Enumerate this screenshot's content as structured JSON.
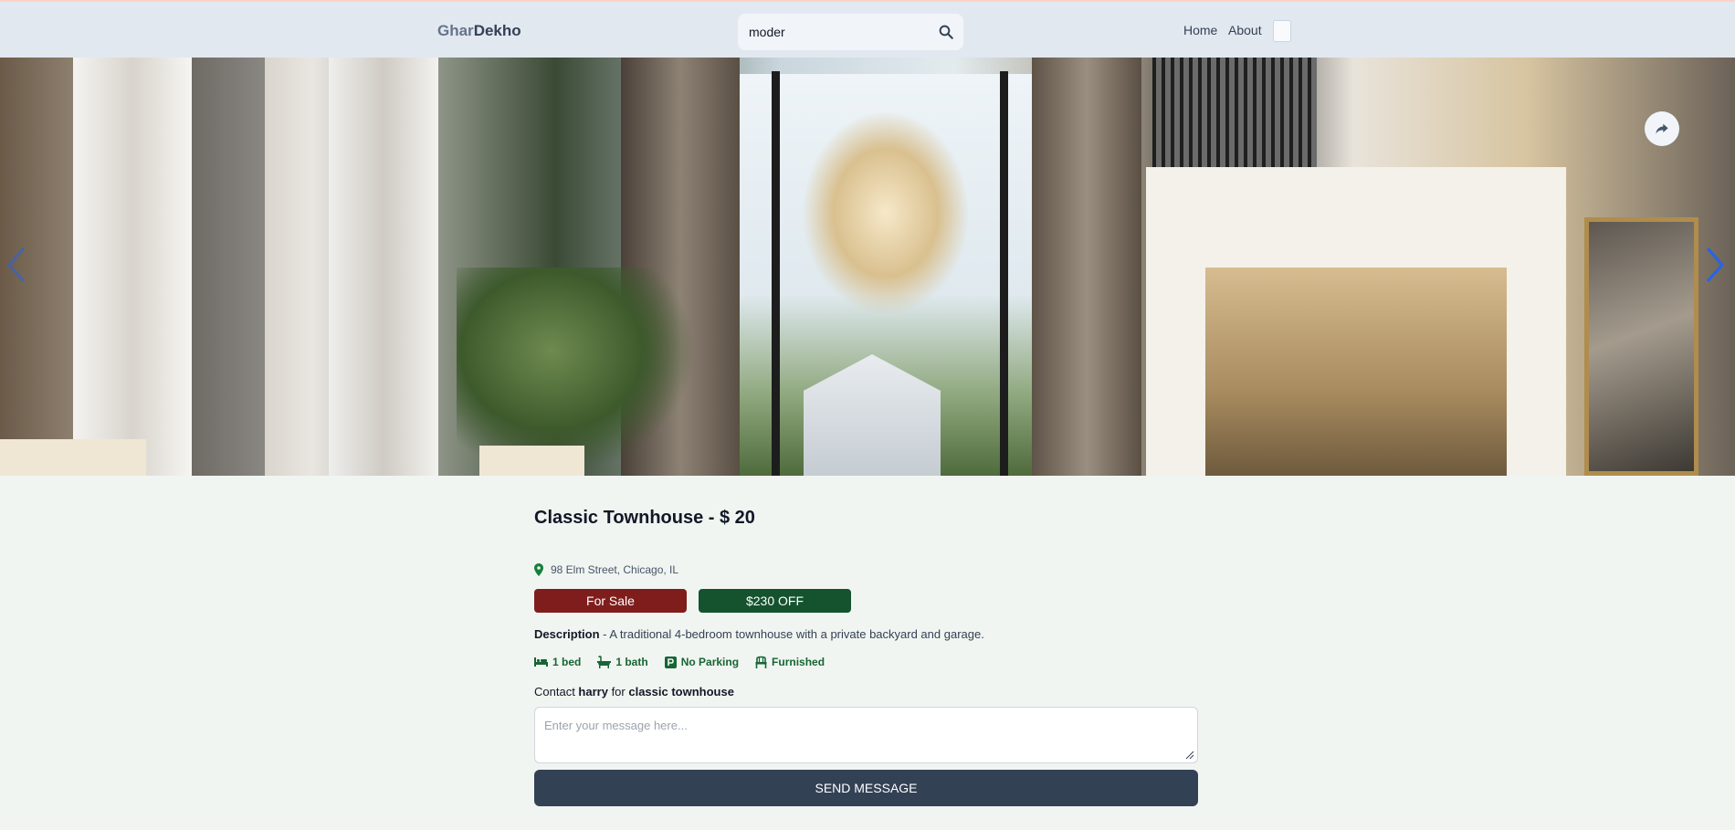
{
  "header": {
    "logo_part1": "Ghar",
    "logo_part2": "Dekho",
    "search_value": "moder",
    "nav": [
      "Home",
      "About"
    ]
  },
  "hero": {
    "icons": [
      "chevron-left-icon",
      "chevron-right-icon",
      "share-icon"
    ]
  },
  "listing": {
    "title": "Classic Townhouse - $ 20",
    "address": "98 Elm Street, Chicago, IL",
    "sale_badge": "For Sale",
    "discount_badge": "$230 OFF",
    "description_label": "Description",
    "description_text": " - A traditional 4-bedroom townhouse with a private backyard and garage.",
    "features": [
      {
        "icon": "bed-icon",
        "label": "1 bed"
      },
      {
        "icon": "bath-icon",
        "label": "1 bath"
      },
      {
        "icon": "parking-icon",
        "label": "No Parking"
      },
      {
        "icon": "chair-icon",
        "label": "Furnished"
      }
    ],
    "contact_prefix": "Contact ",
    "contact_name": "harry",
    "contact_mid": " for ",
    "contact_listing": "classic townhouse",
    "message_placeholder": "Enter your message here...",
    "send_label": "Send Message"
  },
  "colors": {
    "header_bg": "#e2e8f0",
    "page_bg": "#f1f5f1",
    "sale_badge": "#7f1d1d",
    "discount_badge": "#14532d",
    "send_button": "#334155",
    "feature_text": "#166534"
  }
}
